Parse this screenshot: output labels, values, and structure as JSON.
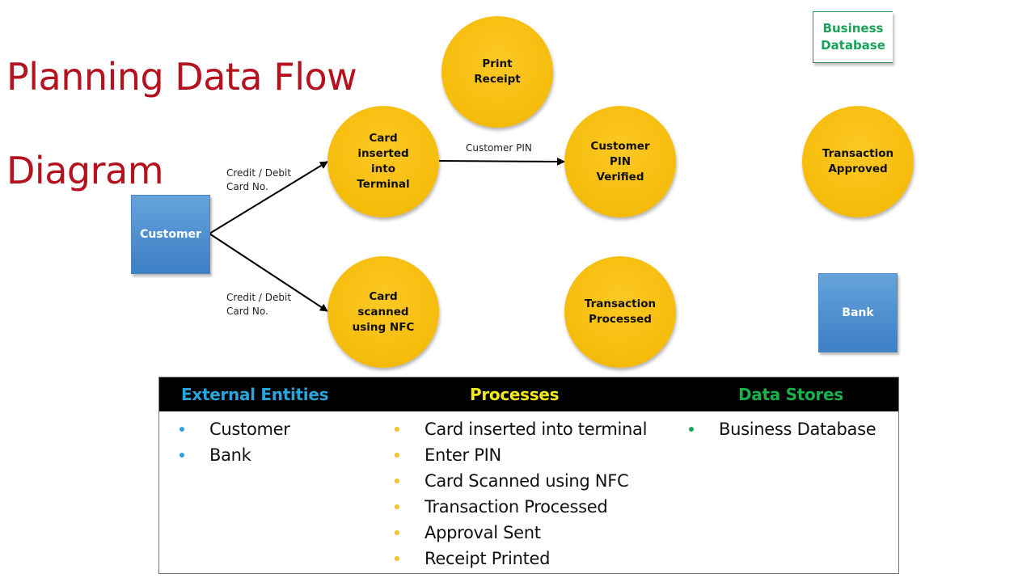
{
  "title": {
    "line1": "Planning Data Flow",
    "line2": "Diagram"
  },
  "colors": {
    "title": "#b3121e",
    "process_fill": "#f5bc0a",
    "entity_fill": "#4f8fd0",
    "datastore_text": "#1aa15a",
    "external_entities_heading": "#2aa4dd",
    "processes_heading": "#f2ea1c",
    "data_stores_heading": "#1bb04e"
  },
  "diagram": {
    "data_store": {
      "line1": "Business",
      "line2": "Database"
    },
    "entities": {
      "customer": "Customer",
      "bank": "Bank"
    },
    "processes": {
      "print_receipt": [
        "Print",
        "Receipt"
      ],
      "card_inserted": [
        "Card",
        "inserted",
        "into",
        "Terminal"
      ],
      "pin_verified": [
        "Customer",
        "PIN",
        "Verified"
      ],
      "transaction_approved": [
        "Transaction",
        "Approved"
      ],
      "card_scanned": [
        "Card",
        "scanned",
        "using NFC"
      ],
      "transaction_processed": [
        "Transaction",
        "Processed"
      ]
    },
    "flows": {
      "customer_to_card_inserted": [
        "Credit / Debit",
        "Card No."
      ],
      "customer_to_card_scanned": [
        "Credit / Debit",
        "Card No."
      ],
      "card_inserted_to_pin_verified": "Customer PIN"
    }
  },
  "legend": {
    "external_entities": {
      "heading": "External Entities",
      "items": [
        "Customer",
        "Bank"
      ]
    },
    "processes": {
      "heading": "Processes",
      "items": [
        "Card inserted into terminal",
        "Enter PIN",
        "Card Scanned using NFC",
        "Transaction Processed",
        "Approval Sent",
        "Receipt Printed"
      ]
    },
    "data_stores": {
      "heading": "Data Stores",
      "items": [
        "Business Database"
      ]
    }
  }
}
